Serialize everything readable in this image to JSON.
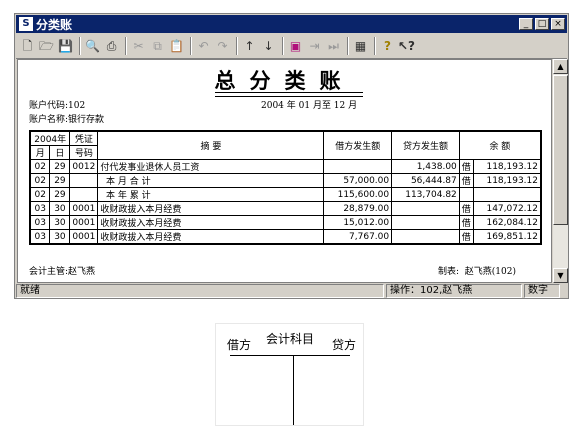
{
  "window": {
    "title": "分类账",
    "app_icon": "S",
    "controls": {
      "minimize": "_",
      "maximize": "□",
      "close": "×"
    }
  },
  "toolbar": {
    "icons": [
      "new-file-icon",
      "open-folder-icon",
      "save-icon",
      "print-preview-icon",
      "print-icon",
      "cut-icon",
      "copy-icon",
      "paste-icon",
      "undo-icon",
      "redo-icon",
      "arrow-up-icon",
      "arrow-down-icon",
      "record-icon",
      "next-record-icon",
      "last-record-icon",
      "calculator-icon",
      "help-icon",
      "context-help-icon"
    ]
  },
  "document": {
    "title": "总分类账",
    "account_code_label": "账户代码:",
    "account_code": "102",
    "period": "2004 年 01 月至 12 月",
    "account_name_label": "账户名称:",
    "account_name": "银行存款",
    "supervisor_label": "会计主管:",
    "supervisor": "赵飞燕",
    "maker_label": "制表:",
    "maker": "赵飞燕(102)"
  },
  "ledger": {
    "headers": {
      "year": "2004年",
      "month": "月",
      "day": "日",
      "voucher": "凭证",
      "voucher_no": "号码",
      "summary": "摘          要",
      "debit": "借方发生额",
      "credit": "贷方发生额",
      "balance": "余        额"
    },
    "rows": [
      {
        "m": "02",
        "d": "29",
        "no": "0012",
        "summary": "付代发事业退休人员工资",
        "debit": "",
        "credit": "1,438.00",
        "dir": "借",
        "balance": "118,193.12"
      },
      {
        "m": "02",
        "d": "29",
        "no": "",
        "summary": "  本 月 合 计",
        "debit": "57,000.00",
        "credit": "56,444.87",
        "dir": "借",
        "balance": "118,193.12"
      },
      {
        "m": "02",
        "d": "29",
        "no": "",
        "summary": "  本 年 累 计",
        "debit": "115,600.00",
        "credit": "113,704.82",
        "dir": "",
        "balance": ""
      },
      {
        "m": "03",
        "d": "30",
        "no": "0001",
        "summary": "收财政拔入本月经费",
        "debit": "28,879.00",
        "credit": "",
        "dir": "借",
        "balance": "147,072.12"
      },
      {
        "m": "03",
        "d": "30",
        "no": "0001",
        "summary": "收财政拔入本月经费",
        "debit": "15,012.00",
        "credit": "",
        "dir": "借",
        "balance": "162,084.12"
      },
      {
        "m": "03",
        "d": "30",
        "no": "0001",
        "summary": "收财政拔入本月经费",
        "debit": "7,767.00",
        "credit": "",
        "dir": "借",
        "balance": "169,851.12"
      }
    ]
  },
  "status": {
    "ready": "就绪",
    "operator": "操作：102,赵飞燕",
    "mode": "数字"
  },
  "t_account": {
    "debit": "借方",
    "subject": "会计科目",
    "credit": "贷方"
  }
}
